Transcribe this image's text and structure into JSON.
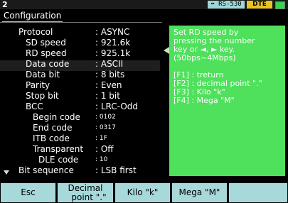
{
  "topbar": {
    "channel": "2",
    "interface": "⬌ RS-530",
    "mode": "DTE",
    "led_color": "#37d552"
  },
  "title": "Configuration",
  "settings": [
    {
      "label": "Protocol",
      "value": ": ASYNC",
      "indent": 0
    },
    {
      "label": "SD speed",
      "value": ": 921.6k",
      "indent": 1
    },
    {
      "label": "RD speed",
      "value": ": 925.1k",
      "indent": 1
    },
    {
      "label": "Data code",
      "value": ": ASCII",
      "indent": 1
    },
    {
      "label": "Data bit",
      "value": ": 8 bits",
      "indent": 1
    },
    {
      "label": "Parity",
      "value": ": Even",
      "indent": 1
    },
    {
      "label": "Stop bit",
      "value": ": 1 bit",
      "indent": 1
    },
    {
      "label": "BCC",
      "value": ": LRC-Odd",
      "indent": 1
    },
    {
      "label": "Begin code",
      "value": ": 0102",
      "indent": 2
    },
    {
      "label": "End code",
      "value": ": 0317",
      "indent": 2
    },
    {
      "label": "ITB code",
      "value": ": 1F",
      "indent": 2
    },
    {
      "label": "Transparent",
      "value": ": Off",
      "indent": 2
    },
    {
      "label": "DLE code",
      "value": ": 10",
      "indent": 3
    },
    {
      "label": "Bit sequence",
      "value": ": LSB first",
      "indent": 0
    }
  ],
  "help": {
    "lines": [
      "Set RD speed by",
      "pressing the number",
      "key or ◄, ► key.",
      "(50bps~4Mbps)",
      "",
      "[F1] : treturn",
      "[F2] : decimal point \".\"",
      "[F3] : Kilo \"k\"",
      "[F4] : Mega \"M\""
    ]
  },
  "softkeys": {
    "f1": "Esc",
    "f2_line1": "Decimal",
    "f2_line2": "point \".\"",
    "f3": "Kilo \"k\"",
    "f4": "Mega \"M\"",
    "f5": ""
  },
  "colors": {
    "help_bg": "#4fe05c",
    "softkey_bg": "#a7d9db",
    "dte_badge": "#e8c323",
    "rs_badge": "#9fd7d8"
  }
}
